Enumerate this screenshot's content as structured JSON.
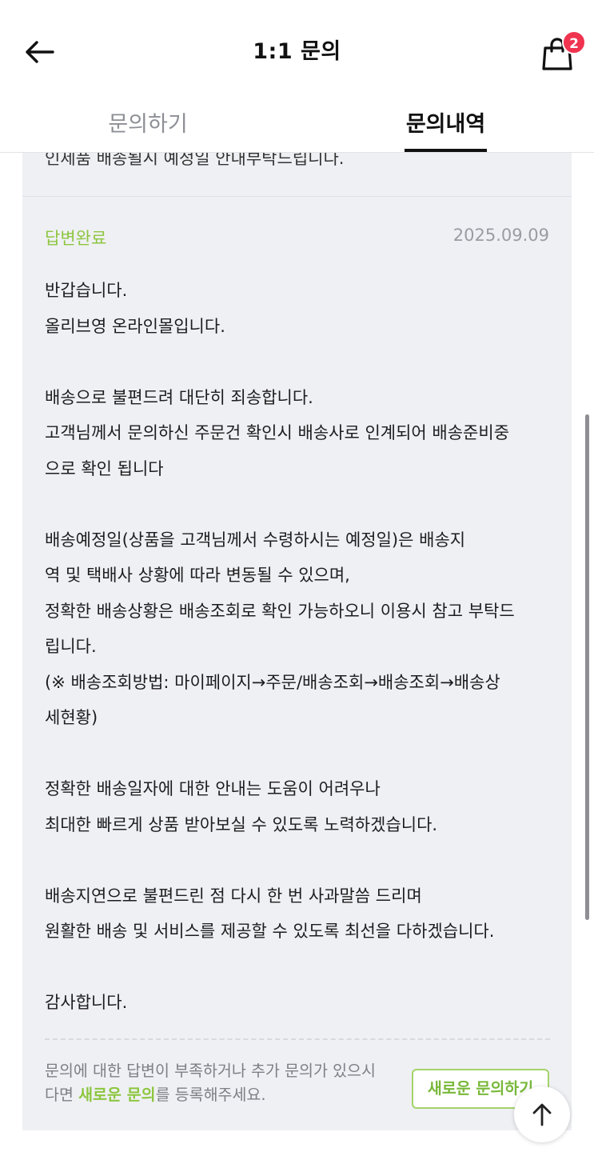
{
  "header": {
    "title": "1:1 문의",
    "cart_count": "2",
    "back_icon": "arrow-left-icon",
    "cart_icon": "shopping-bag-icon"
  },
  "tabs": [
    {
      "label": "문의하기",
      "active": false
    },
    {
      "label": "문의내역",
      "active": true
    }
  ],
  "previous_item": {
    "clipped_text": "인제품 배송될시 예정일 안내부탁드립니다."
  },
  "answer": {
    "status": "답변완료",
    "date": "2025.09.09",
    "body": "반갑습니다.\n올리브영 온라인몰입니다.\n\n배송으로 불편드려 대단히 죄송합니다.\n고객님께서 문의하신 주문건 확인시 배송사로 인계되어 배송준비중\n으로 확인 됩니다\n\n배송예정일(상품을 고객님께서 수령하시는 예정일)은 배송지\n역 및 택배사 상황에 따라 변동될 수 있으며,\n정확한 배송상황은 배송조회로 확인 가능하오니 이용시 참고 부탁드\n립니다.\n(※ 배송조회방법: 마이페이지→주문/배송조회→배송조회→배송상\n세현황)\n\n정확한 배송일자에 대한 안내는 도움이 어려우나\n최대한 빠르게 상품 받아보실 수 있도록 노력하겠습니다.\n\n배송지연으로 불편드린 점 다시 한 번 사과말씀 드리며\n원활한 배송 및 서비스를 제공할 수 있도록 최선을 다하겠습니다.\n\n감사합니다."
  },
  "footer": {
    "note_part1": "문의에 대한 답변이 부족하거나 추가 문의가 있으시다면 ",
    "note_highlight": "새로운 문의",
    "note_part2": "를 등록해주세요.",
    "button_label": "새로운 문의하기"
  },
  "colors": {
    "accent_green": "#8dc63f",
    "badge_red": "#f0334f",
    "content_bg": "#eff0f4"
  },
  "scroll_top_icon": "arrow-up-icon"
}
